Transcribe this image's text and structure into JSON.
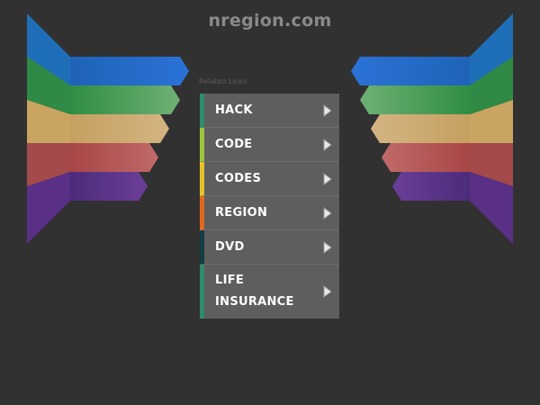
{
  "site": {
    "title": "nregion.com"
  },
  "related": {
    "label": "Related Links"
  },
  "links": [
    {
      "label": "HACK",
      "accent": "#2e8b6e"
    },
    {
      "label": "CODE",
      "accent": "#9bc53d"
    },
    {
      "label": "CODES",
      "accent": "#e6c22a"
    },
    {
      "label": "REGION",
      "accent": "#e0691f"
    },
    {
      "label": "DVD",
      "accent": "#163b44"
    },
    {
      "label": "LIFE INSURANCE",
      "accent": "#2e8b6e"
    }
  ],
  "icons": {
    "link_arrow": "triangle-right-icon"
  },
  "wing_colors": [
    "#1e6fc9",
    "#35a04a",
    "#d6ac56",
    "#b84b4b",
    "#5b2c8f"
  ]
}
